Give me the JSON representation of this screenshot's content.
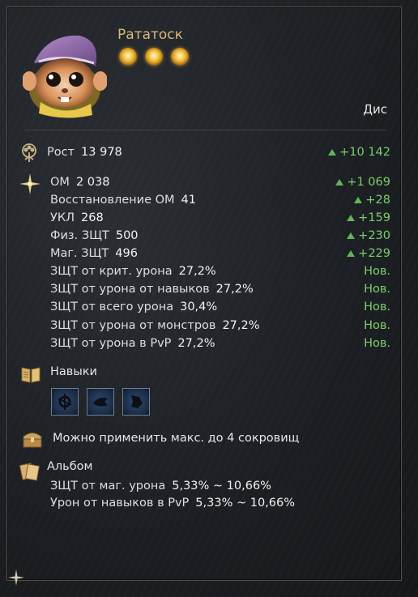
{
  "pet": {
    "name": "Рататоск",
    "star_count": 3,
    "class_label": "Дис"
  },
  "stats": {
    "health": {
      "label": "Рост",
      "value": "13 978",
      "bonus": "+10 142"
    },
    "rows": [
      {
        "label": "ОМ",
        "value": "2 038",
        "bonus": "+1 069"
      },
      {
        "label": "Восстановление ОМ",
        "value": "41",
        "bonus": "+28"
      },
      {
        "label": "УКЛ",
        "value": "268",
        "bonus": "+159"
      },
      {
        "label": "Физ. ЗЩТ",
        "value": "500",
        "bonus": "+230"
      },
      {
        "label": "Маг. ЗЩТ",
        "value": "496",
        "bonus": "+229"
      },
      {
        "label": "ЗЩТ от крит. урона",
        "value": "27,2%",
        "tag": "Нов."
      },
      {
        "label": "ЗЩТ от урона от навыков",
        "value": "27,2%",
        "tag": "Нов."
      },
      {
        "label": "ЗЩТ от всего урона",
        "value": "30,4%",
        "tag": "Нов."
      },
      {
        "label": "ЗЩТ от урона от монстров",
        "value": "27,2%",
        "tag": "Нов."
      },
      {
        "label": "ЗЩТ от урона в PvP",
        "value": "27,2%",
        "tag": "Нов."
      }
    ]
  },
  "skills": {
    "title": "Навыки",
    "items": [
      "skill-icon-1",
      "skill-icon-2",
      "skill-icon-3"
    ]
  },
  "treasure": {
    "text": "Можно применить макс. до 4 сокровищ"
  },
  "album": {
    "title": "Альбом",
    "lines": [
      {
        "label": "ЗЩТ от маг. урона",
        "value": "5,33% ~ 10,66%"
      },
      {
        "label": "Урон от навыков в PvP",
        "value": "5,33% ~ 10,66%"
      }
    ]
  },
  "colors": {
    "name": "#d8b97b",
    "bonus": "#7ccf6c",
    "text": "#e6e6e6",
    "frame": "#57524a"
  }
}
